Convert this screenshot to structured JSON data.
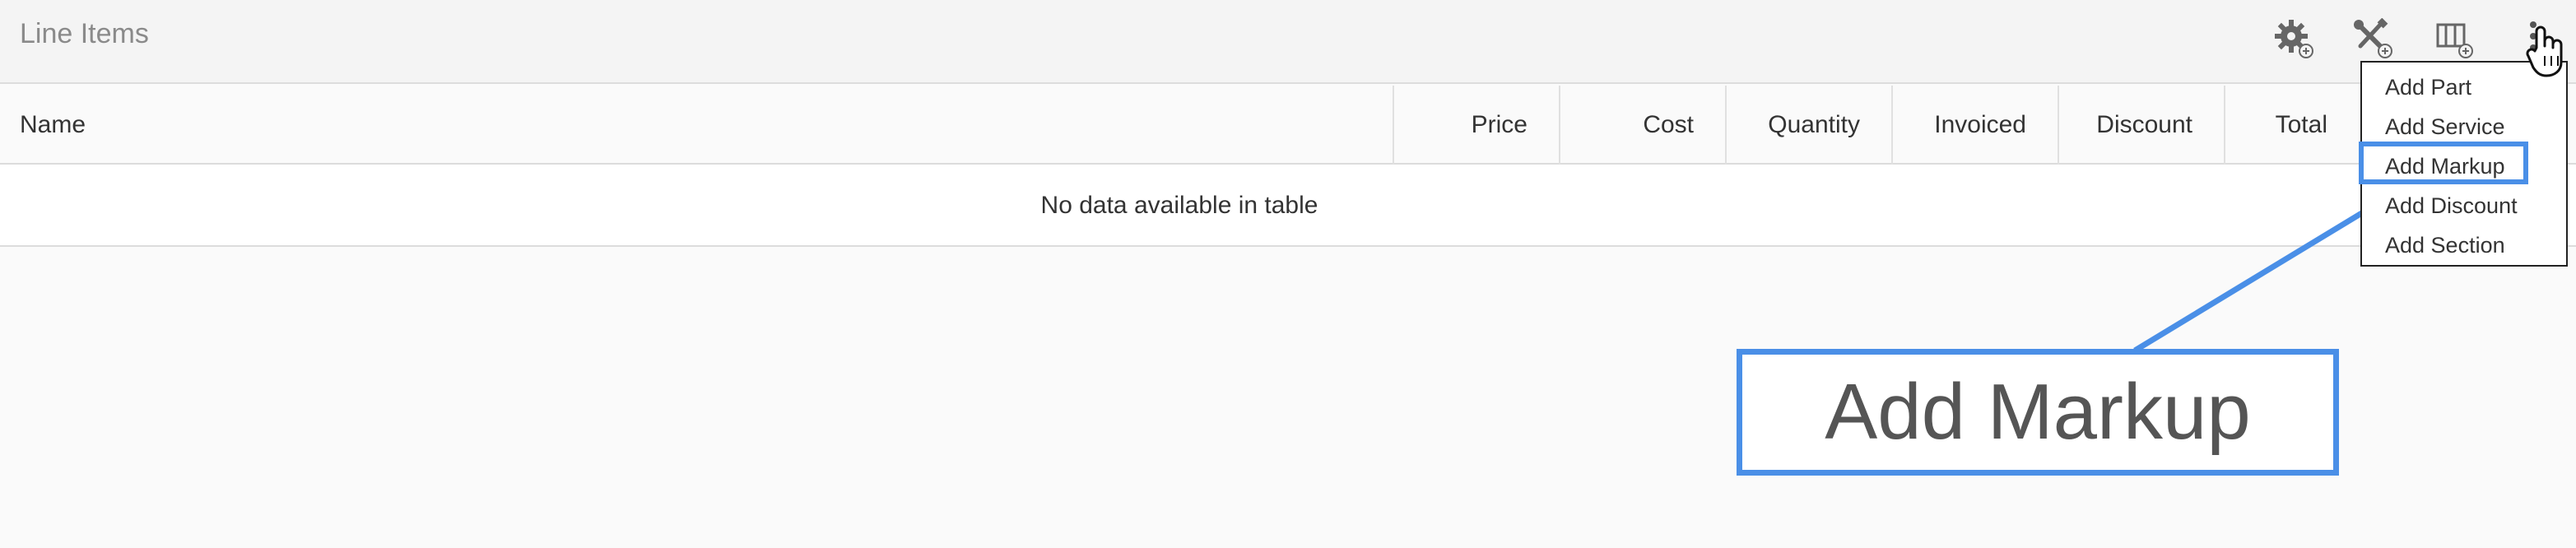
{
  "header": {
    "title": "Line Items",
    "icons": [
      "settings-add-icon",
      "tools-add-icon",
      "columns-add-icon",
      "more-vertical-icon"
    ]
  },
  "table": {
    "columns": [
      "Name",
      "Price",
      "Cost",
      "Quantity",
      "Invoiced",
      "Discount",
      "Total"
    ],
    "empty_message": "No data available in table"
  },
  "menu": {
    "items": [
      "Add Part",
      "Add Service",
      "Add Markup",
      "Add Discount",
      "Add Section"
    ],
    "highlighted": "Add Markup"
  },
  "callout": {
    "text": "Add Markup"
  },
  "colors": {
    "highlight": "#4a8fe7",
    "header_bg": "#f4f4f4",
    "title_gray": "#8a8a8a"
  }
}
